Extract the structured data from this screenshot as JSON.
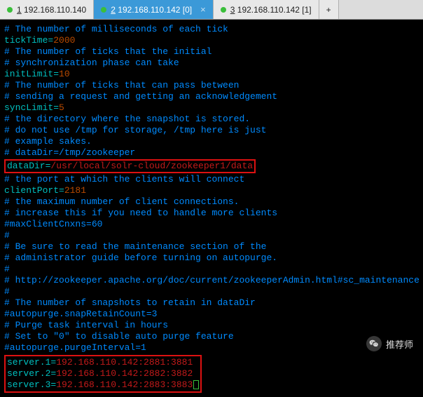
{
  "tabs": {
    "items": [
      {
        "index": "1",
        "label": "192.168.110.140",
        "active": false
      },
      {
        "index": "2",
        "label": "192.168.110.142 [0]",
        "active": true
      },
      {
        "index": "3",
        "label": "192.168.110.142 [1]",
        "active": false
      }
    ],
    "add": "+"
  },
  "config": {
    "c1": "# The number of milliseconds of each tick",
    "k1": "tickTime",
    "v1": "2000",
    "c2": "# The number of ticks that the initial",
    "c3": "# synchronization phase can take",
    "k2": "initLimit",
    "v2": "10",
    "c4": "# The number of ticks that can pass between",
    "c5": "# sending a request and getting an acknowledgement",
    "k3": "syncLimit",
    "v3": "5",
    "c6": "# the directory where the snapshot is stored.",
    "c7": "# do not use /tmp for storage, /tmp here is just",
    "c8": "# example sakes.",
    "c9": "# dataDir=/tmp/zookeeper",
    "k4": "dataDir",
    "v4": "/usr/local/solr-cloud/zookeeper1/data",
    "c10": "# the port at which the clients will connect",
    "k5": "clientPort",
    "v5": "2181",
    "c11": "# the maximum number of client connections.",
    "c12": "# increase this if you need to handle more clients",
    "c13": "#maxClientCnxns=60",
    "c14": "#",
    "c15": "# Be sure to read the maintenance section of the",
    "c16": "# administrator guide before turning on autopurge.",
    "c17": "#",
    "c18": "# http://zookeeper.apache.org/doc/current/zookeeperAdmin.html#sc_maintenance",
    "c19": "#",
    "c20": "# The number of snapshots to retain in dataDir",
    "c21": "#autopurge.snapRetainCount=3",
    "c22": "# Purge task interval in hours",
    "c23": "# Set to \"0\" to disable auto purge feature",
    "c24": "#autopurge.purgeInterval=1",
    "sk1": "server.1",
    "sv1": "192.168.110.142:2881:3881",
    "sk2": "server.2",
    "sv2": "192.168.110.142:2882:3882",
    "sk3": "server.3",
    "sv3": "192.168.110.142:2883:3883"
  },
  "watermark": {
    "label": "推荐师"
  }
}
